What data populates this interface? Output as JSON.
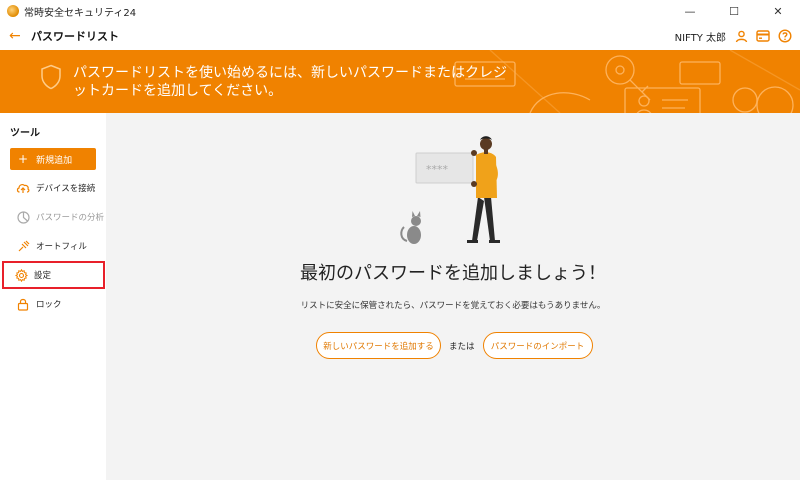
{
  "window": {
    "app_title": "常時安全セキュリティ24",
    "minimize_glyph": "—",
    "maximize_glyph": "☐",
    "close_glyph": "✕"
  },
  "header": {
    "back_glyph": "←",
    "title": "パスワードリスト",
    "user_name": "NIFTY 太郎",
    "icons": [
      "user-icon",
      "card-icon",
      "help-icon"
    ]
  },
  "banner": {
    "message": "パスワードリストを使い始めるには、新しいパスワードまたはクレジットカードを追加してください。",
    "icon": "shield-icon"
  },
  "sidebar": {
    "heading": "ツール",
    "add_button": {
      "plus": "+",
      "label": "新規追加"
    },
    "items": [
      {
        "label": "デバイスを接続",
        "icon": "cloud-upload-icon",
        "disabled": false
      },
      {
        "label": "パスワードの分析",
        "icon": "pie-chart-icon",
        "disabled": true
      },
      {
        "label": "オートフィル",
        "icon": "autofill-icon",
        "disabled": false
      },
      {
        "label": "設定",
        "icon": "gear-icon",
        "disabled": false,
        "highlighted": true
      },
      {
        "label": "ロック",
        "icon": "lock-icon",
        "disabled": false
      }
    ]
  },
  "main": {
    "card_text": "****",
    "heading": "最初のパスワードを追加しましょう！",
    "subtext": "リストに安全に保管されたら、パスワードを覚えておく必要はもうありません。",
    "new_password_button": "新しいパスワードを追加する",
    "or_text": "または",
    "import_button": "パスワードのインポート"
  },
  "colors": {
    "accent": "#f08200",
    "highlight_border": "#e8202a",
    "background": "#f3f3f3"
  }
}
